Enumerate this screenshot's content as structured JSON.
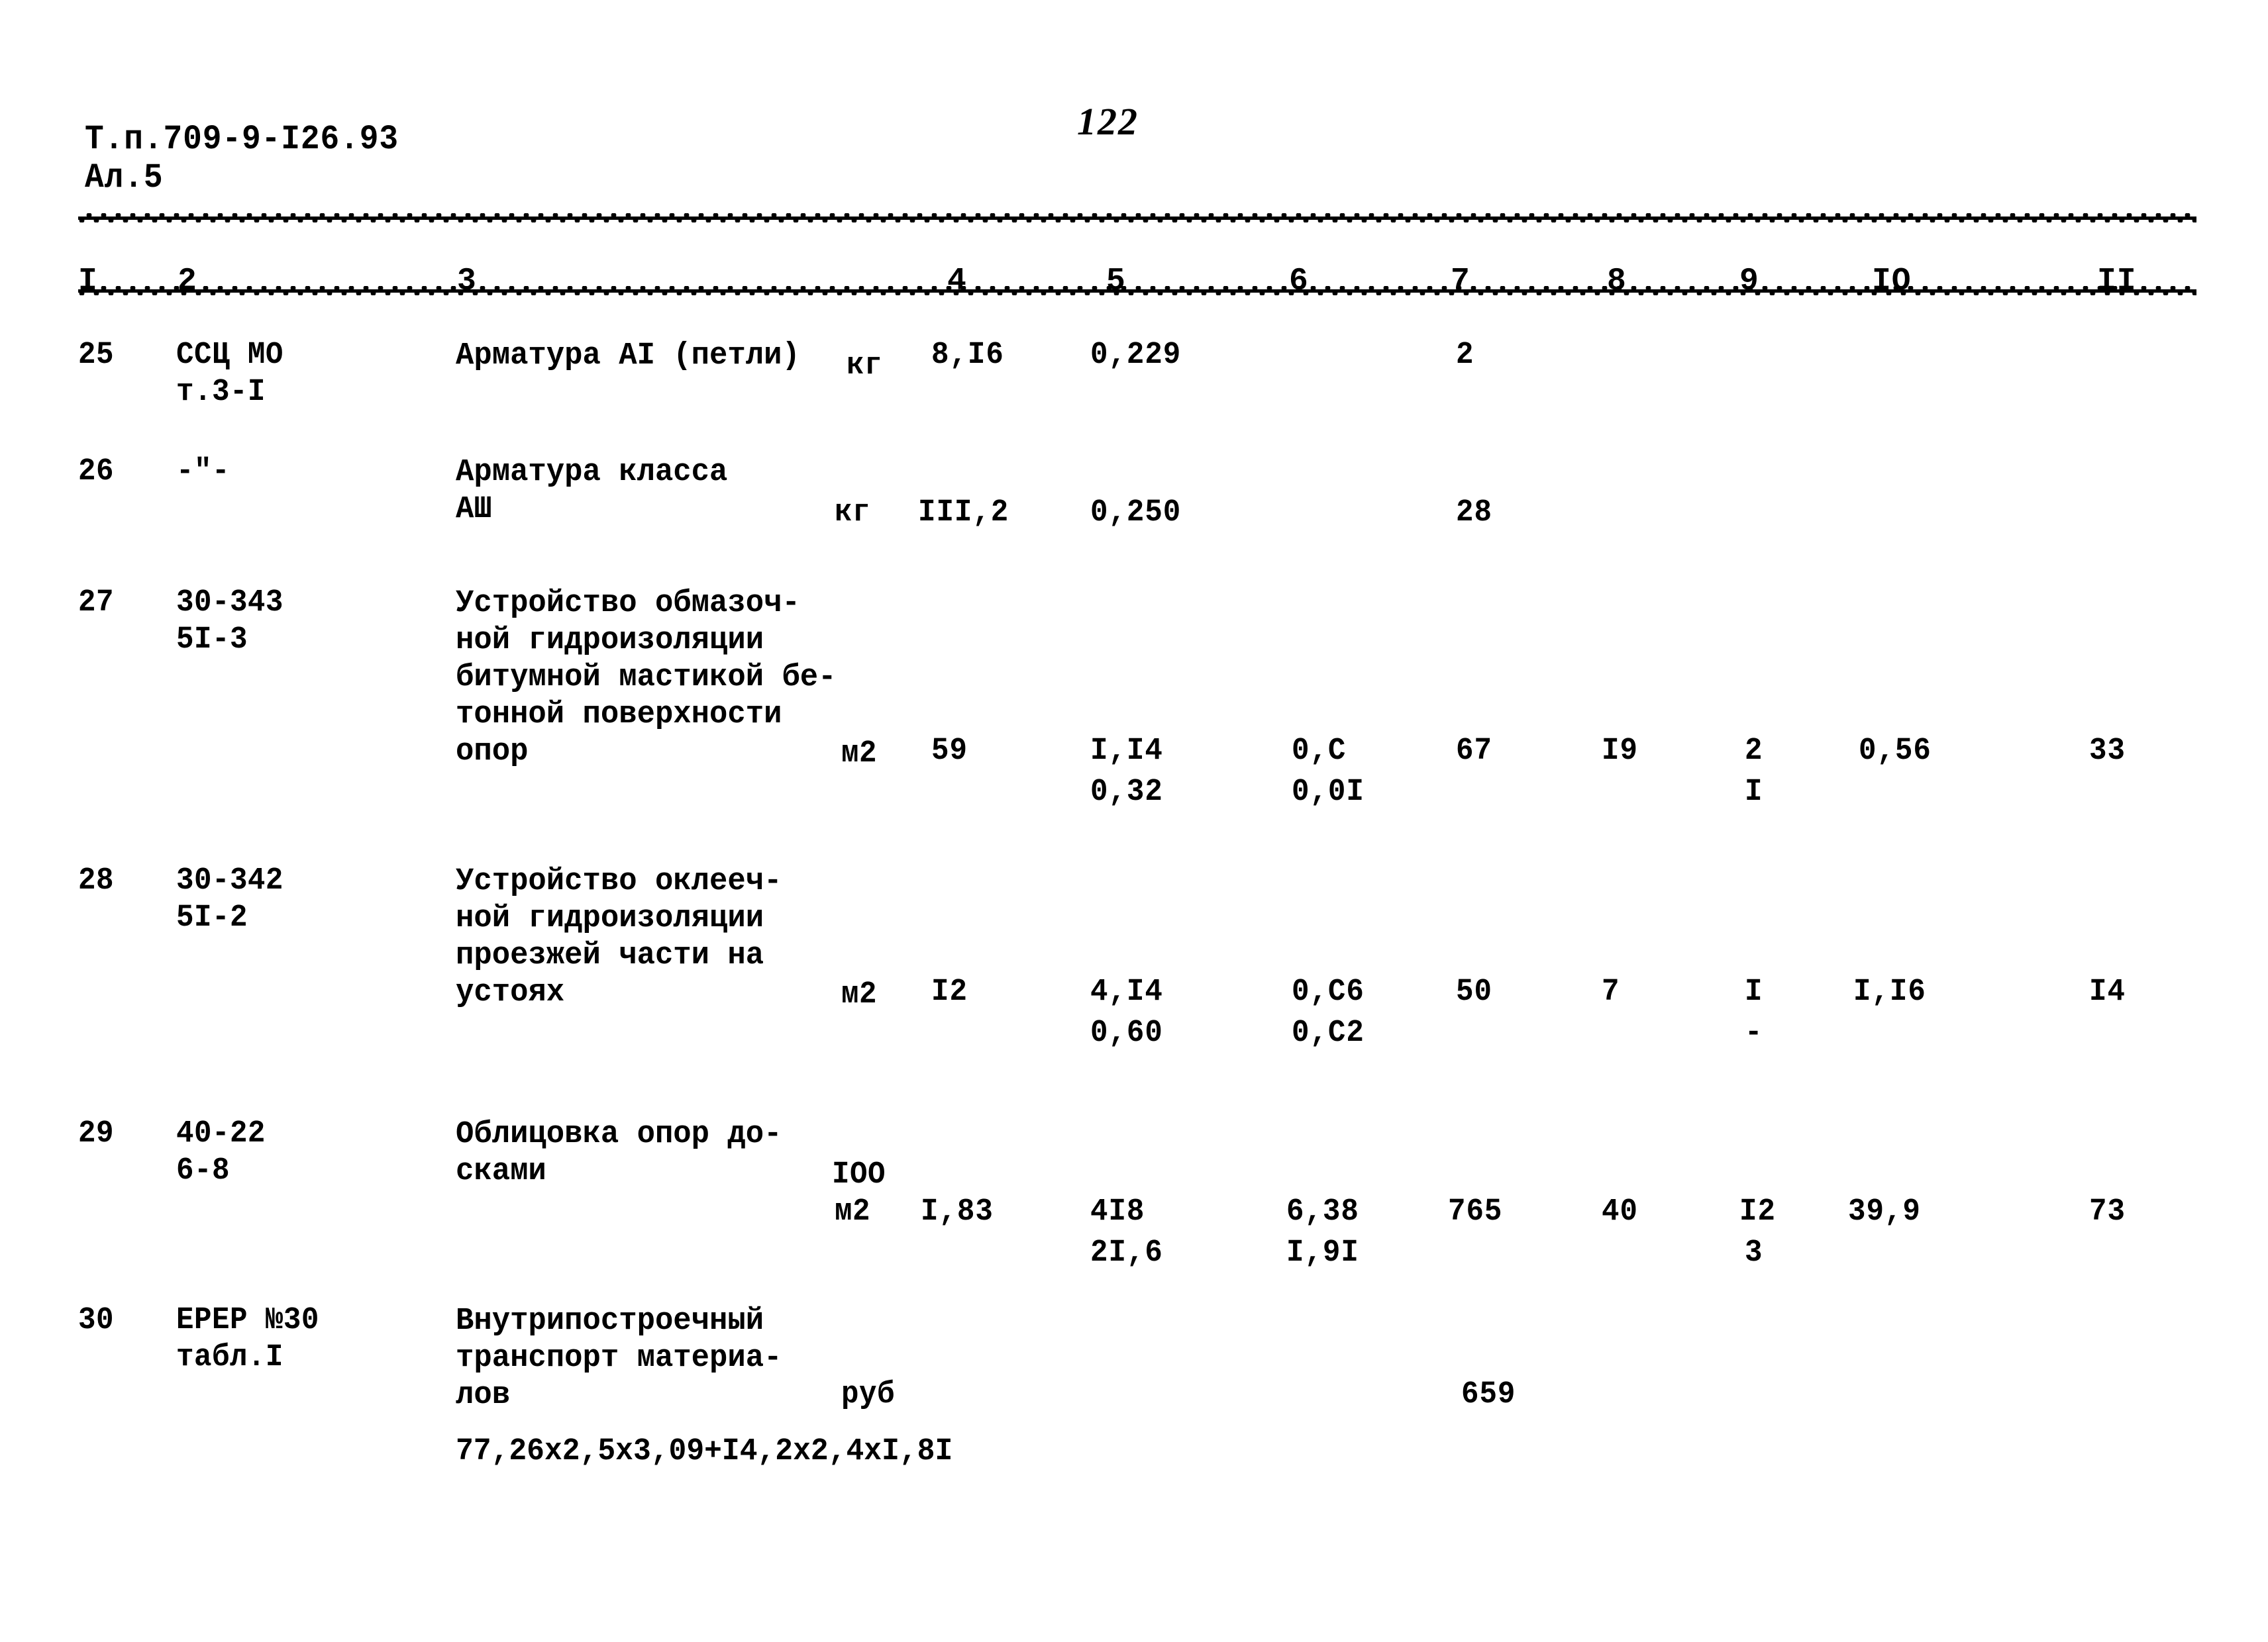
{
  "document": {
    "code_line1": "Т.п.709-9-I26.93",
    "code_line2": "Ал.5",
    "page_number": "122"
  },
  "table": {
    "column_headers": [
      "I",
      "2",
      "3",
      "4",
      "5",
      "6",
      "7",
      "8",
      "9",
      "IO",
      "II"
    ],
    "rows": [
      {
        "num": "25",
        "ref_line1": "ССЦ МО",
        "ref_line2": "т.3-I",
        "desc_line1": "Арматура АI (петли)",
        "desc_line2": "",
        "desc_line3": "",
        "desc_line4": "",
        "unit_line1": "кг",
        "unit_line2": "",
        "c4": "8,I6",
        "c5a": "0,229",
        "c5b": "",
        "c6a": "",
        "c6b": "",
        "c7": "2",
        "c8": "",
        "c9a": "",
        "c9b": "",
        "c10": "",
        "c11": ""
      },
      {
        "num": "26",
        "ref_line1": "-\"-",
        "ref_line2": "",
        "desc_line1": "Арматура класса",
        "desc_line2": "АШ",
        "desc_line3": "",
        "desc_line4": "",
        "unit_line1": "",
        "unit_line2": "кг",
        "c4": "III,2",
        "c5a": "0,250",
        "c5b": "",
        "c6a": "",
        "c6b": "",
        "c7": "28",
        "c8": "",
        "c9a": "",
        "c9b": "",
        "c10": "",
        "c11": ""
      },
      {
        "num": "27",
        "ref_line1": "30-343",
        "ref_line2": "5I-3",
        "desc_line1": "Устройство обмазоч-",
        "desc_line2": "ной гидроизоляции",
        "desc_line3": "битумной мастикой бе-",
        "desc_line4": "тонной поверхности",
        "desc_line5": "опор",
        "unit_line1": "м2",
        "unit_line2": "",
        "c4": "59",
        "c5a": "I,I4",
        "c5b": "0,32",
        "c6a": "0,С",
        "c6b": "0,0I",
        "c7": "67",
        "c8": "I9",
        "c9a": "2",
        "c9b": "I",
        "c10": "0,56",
        "c11": "33"
      },
      {
        "num": "28",
        "ref_line1": "30-342",
        "ref_line2": "5I-2",
        "desc_line1": "Устройство оклееч-",
        "desc_line2": "ной гидроизоляции",
        "desc_line3": "проезжей части на",
        "desc_line4": "устоях",
        "desc_line5": "",
        "unit_line1": "м2",
        "unit_line2": "",
        "c4": "I2",
        "c5a": "4,I4",
        "c5b": "0,60",
        "c6a": "0,С6",
        "c6b": "0,С2",
        "c7": "50",
        "c8": "7",
        "c9a": "I",
        "c9b": "-",
        "c10": "I,I6",
        "c11": "I4"
      },
      {
        "num": "29",
        "ref_line1": "40-22",
        "ref_line2": "6-8",
        "desc_line1": "Облицовка опор до-",
        "desc_line2": "сками",
        "desc_line3": "",
        "desc_line4": "",
        "desc_line5": "",
        "unit_line1": "IOO",
        "unit_line2": "м2",
        "c4": "I,83",
        "c5a": "4I8",
        "c5b": "2I,6",
        "c6a": "6,38",
        "c6b": "I,9I",
        "c7": "765",
        "c8": "40",
        "c9a": "I2",
        "c9b": "3",
        "c10": "39,9",
        "c11": "73"
      },
      {
        "num": "30",
        "ref_line1": "ЕРЕР №30",
        "ref_line2": "табл.I",
        "desc_line1": "Внутрипостроечный",
        "desc_line2": "транспорт материа-",
        "desc_line3": "лов",
        "desc_line4": "",
        "desc_line5": "",
        "unit_line1": "",
        "unit_line2": "",
        "unit_line3": "руб",
        "formula": "77,26х2,5х3,09+I4,2х2,4хI,8I",
        "c4": "",
        "c5a": "",
        "c5b": "",
        "c6a": "",
        "c6b": "",
        "c7": "659",
        "c8": "",
        "c9a": "",
        "c9b": "",
        "c10": "",
        "c11": ""
      }
    ]
  }
}
